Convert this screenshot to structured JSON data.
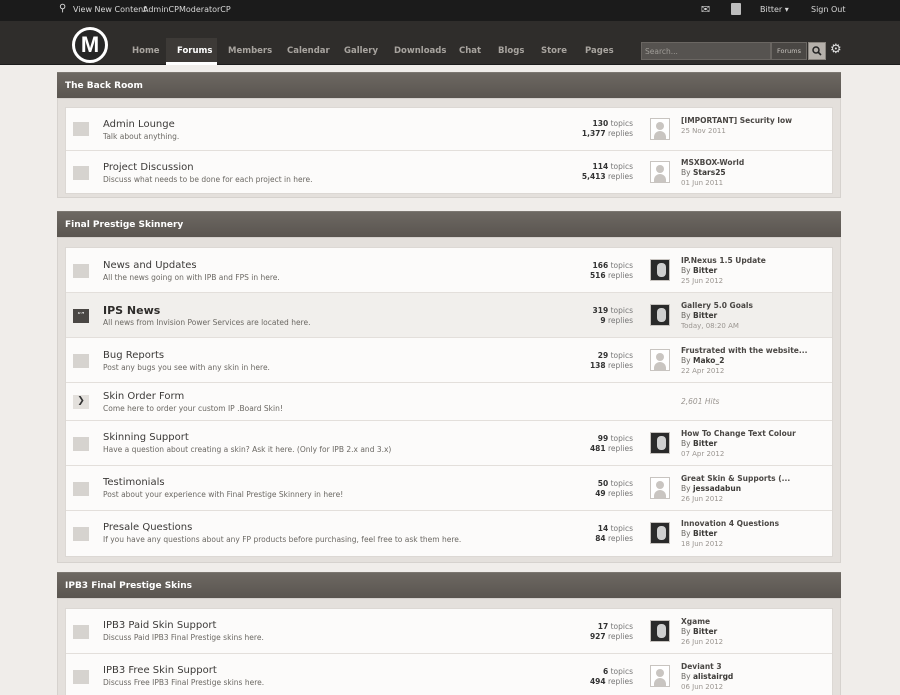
{
  "userbar": {
    "view_new": "View New Content",
    "admincp": "AdminCP",
    "modcp": "ModeratorCP",
    "username": "Bitter",
    "signout": "Sign Out"
  },
  "logo_letter": "M",
  "tabs": [
    "Home",
    "Forums",
    "Members",
    "Calendar",
    "Gallery",
    "Downloads",
    "Chat",
    "Blogs",
    "Store",
    "Pages"
  ],
  "search": {
    "placeholder": "Search...",
    "scope": "Forums"
  },
  "categories": [
    {
      "title": "The Back Room",
      "forums": [
        {
          "name": "Admin Lounge",
          "desc": "Talk about anything.",
          "topics": "130",
          "replies": "1,377",
          "lp_title": "[IMPORTANT] Security low",
          "lp_by": "",
          "lp_date": "25 Nov 2011"
        },
        {
          "name": "Project Discussion",
          "desc": "Discuss what needs to be done for each project in here.",
          "topics": "114",
          "replies": "5,413",
          "lp_title": "MSXBOX-World",
          "lp_by": "Stars25",
          "lp_date": "01 Jun 2011"
        }
      ]
    },
    {
      "title": "Final Prestige Skinnery",
      "forums": [
        {
          "name": "News and Updates",
          "desc": "All the news going on with IPB and FPS in here.",
          "topics": "166",
          "replies": "516",
          "lp_title": "IP.Nexus 1.5 Update",
          "lp_by": "Bitter",
          "lp_date": "25 Jun 2012"
        },
        {
          "name": "IPS News",
          "desc": "All news from Invision Power Services are located here.",
          "topics": "319",
          "replies": "9",
          "lp_title": "Gallery 5.0 Goals",
          "lp_by": "Bitter",
          "lp_date": "Today, 08:20 AM"
        },
        {
          "name": "Bug Reports",
          "desc": "Post any bugs you see with any skin in here.",
          "topics": "29",
          "replies": "138",
          "lp_title": "Frustrated with the website...",
          "lp_by": "Mako_2",
          "lp_date": "22 Apr 2012"
        },
        {
          "name": "Skin Order Form",
          "desc": "Come here to order your custom IP .Board Skin!",
          "hits": "2,601 Hits"
        },
        {
          "name": "Skinning Support",
          "desc": "Have a question about creating a skin? Ask it here. (Only for IPB 2.x and 3.x)",
          "topics": "99",
          "replies": "481",
          "lp_title": "How To Change Text Colour",
          "lp_by": "Bitter",
          "lp_date": "07 Apr 2012"
        },
        {
          "name": "Testimonials",
          "desc": "Post about your experience with Final Prestige Skinnery in here!",
          "topics": "50",
          "replies": "49",
          "lp_title": "Great Skin & Supports (...",
          "lp_by": "jessadabun",
          "lp_date": "26 Jun 2012"
        },
        {
          "name": "Presale Questions",
          "desc": "If you have any questions about any FP products before purchasing, feel free to ask them here.",
          "topics": "14",
          "replies": "84",
          "lp_title": "Innovation 4 Questions",
          "lp_by": "Bitter",
          "lp_date": "18 Jun 2012"
        }
      ]
    },
    {
      "title": "IPB3 Final Prestige Skins",
      "forums": [
        {
          "name": "IPB3 Paid Skin Support",
          "desc": "Discuss Paid IPB3 Final Prestige skins here.",
          "topics": "17",
          "replies": "927",
          "lp_title": "Xgame",
          "lp_by": "Bitter",
          "lp_date": "26 Jun 2012"
        },
        {
          "name": "IPB3 Free Skin Support",
          "desc": "Discuss Free IPB3 Final Prestige skins here.",
          "topics": "6",
          "replies": "494",
          "lp_title": "Deviant 3",
          "lp_by": "alistairgd",
          "lp_date": "06 Jun 2012"
        }
      ]
    }
  ],
  "labels": {
    "topics": "topics",
    "replies": "replies",
    "by": "By"
  }
}
